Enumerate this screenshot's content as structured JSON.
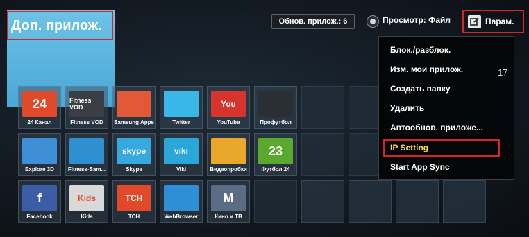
{
  "header": {
    "title": "Доп. прилож.",
    "updates_label": "Обнов. прилож.: 6",
    "view_label": "Просмотр: Файл",
    "params_label": "Парам."
  },
  "apps": [
    {
      "label": "24 Канал",
      "icon": "tv-24-icon",
      "icon_text": "24",
      "color": "#e04a2a"
    },
    {
      "label": "Fitness VOD",
      "icon": "fitness-vod-icon",
      "icon_text": "Fitness VOD",
      "color": "#3b3f45"
    },
    {
      "label": "Samsung Apps",
      "icon": "samsung-apps-icon",
      "icon_text": "",
      "color": "#e2593a"
    },
    {
      "label": "Twitter",
      "icon": "twitter-icon",
      "icon_text": "",
      "color": "#3ab7e8"
    },
    {
      "label": "YouTube",
      "icon": "youtube-icon",
      "icon_text": "You",
      "color": "#d8342e"
    },
    {
      "label": "Профутбол",
      "icon": "football-club-icon",
      "icon_text": "",
      "color": "#2a2f35"
    },
    {
      "label": "Explore 3D",
      "icon": "explore-3d-icon",
      "icon_text": "",
      "color": "#3f8fd6"
    },
    {
      "label": "Fitness-Sam...",
      "icon": "fitness-runner-icon",
      "icon_text": "",
      "color": "#2f8fd0"
    },
    {
      "label": "Skype",
      "icon": "skype-icon",
      "icon_text": "skype",
      "color": "#36a9df"
    },
    {
      "label": "Viki",
      "icon": "viki-icon",
      "icon_text": "viki",
      "color": "#2aa7d8"
    },
    {
      "label": "Видеопробки",
      "icon": "traffic-video-icon",
      "icon_text": "",
      "color": "#e9a72b"
    },
    {
      "label": "Футбол 24",
      "icon": "football-24-icon",
      "icon_text": "23",
      "color": "#5aa82e"
    },
    {
      "label": "Facebook",
      "icon": "facebook-icon",
      "icon_text": "f",
      "color": "#3b5da6"
    },
    {
      "label": "Kids",
      "icon": "kids-icon",
      "icon_text": "Kids",
      "color": "#d9d9d9"
    },
    {
      "label": "TCH",
      "icon": "tch-icon",
      "icon_text": "ТСН",
      "color": "#e0492a"
    },
    {
      "label": "WebBrowser",
      "icon": "web-browser-icon",
      "icon_text": "",
      "color": "#2f8fd6"
    },
    {
      "label": "Кино и ТВ",
      "icon": "movies-tv-icon",
      "icon_text": "M",
      "color": "#5b6d84"
    }
  ],
  "menu": {
    "items": [
      "Блок./разблок.",
      "Изм. мои прилож.",
      "Создать папку",
      "Удалить",
      "Автообнов. приложе...",
      "IP Setting",
      "Start App Sync"
    ],
    "highlighted": "IP Setting"
  },
  "side_count": "17",
  "colors": {
    "highlight_red": "#d8232a",
    "hero_blue": "#5bb5e1"
  }
}
